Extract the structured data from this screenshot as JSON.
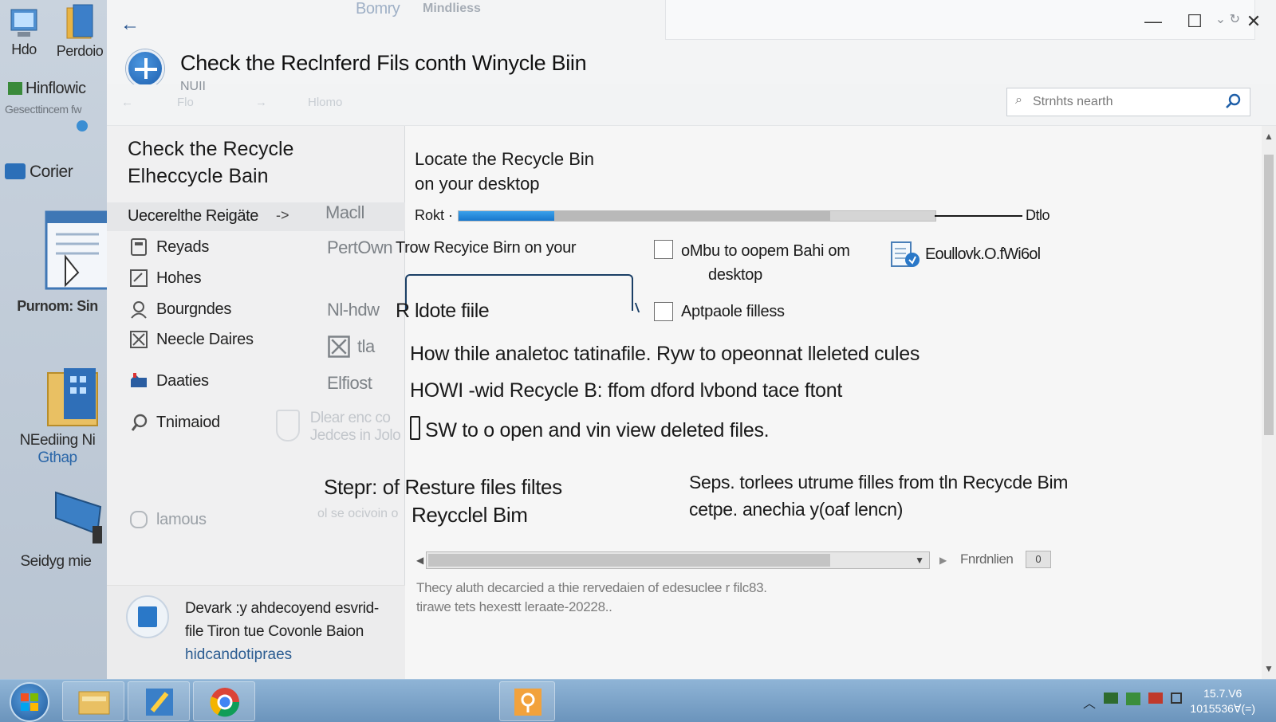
{
  "desktop": {
    "icons": [
      {
        "label": "Hdo"
      },
      {
        "label": "Perdoio"
      },
      {
        "label": "Hinflowic"
      },
      {
        "label": "Gesecttincem fw"
      },
      {
        "label": "Corier"
      },
      {
        "label": "Purnom: Sin"
      },
      {
        "label": "NEediing Ni"
      },
      {
        "label": "Gthap"
      },
      {
        "label": "Seidyg mie"
      }
    ]
  },
  "window": {
    "ghost_title": "Bomry",
    "ghost_sub": "Mindliess",
    "title": "Check the Reclnferd Fils conth Winycle Biin",
    "title_sub": "NUII",
    "controls": {
      "minimize": "—",
      "maximize": "☐",
      "close": "✕"
    },
    "cmdbar": {
      "faint_1": "Flo",
      "faint_2": "Hlomo"
    },
    "search": {
      "placeholder": "Strnhts nearth"
    }
  },
  "leftpane": {
    "heading_line1": "Check the Recycle",
    "heading_line2": "Elheccycle Bain",
    "selected": {
      "label": "Uecerelthe Reigäte",
      "arrow": "->"
    },
    "nav": [
      {
        "label": "Reyads",
        "icon": "recycle-bin-icon",
        "col2": "Macll"
      },
      {
        "label": "Hohes",
        "icon": "checkbox-icon",
        "col2": "PertOwn"
      },
      {
        "label": "Bourgndes",
        "icon": "person-icon",
        "col2": "Nl-hdw"
      },
      {
        "label": "Neecle Daires",
        "icon": "crossed-box-icon",
        "col2": "tla"
      },
      {
        "label": "Daaties",
        "icon": "folder-icon",
        "col2": "Elfiost"
      },
      {
        "label": "Tnimaiod",
        "icon": "link-icon",
        "col2": "Dlear enc co"
      },
      {
        "label": "lamous",
        "icon": "circle-icon",
        "col2": ""
      }
    ],
    "col2_extra": "Jedces in Jolo",
    "bottom": {
      "line1": "Devark :y ahdecoyend esvrid-",
      "line2": "file Tiron tue Covonle Baion",
      "link": "hidcandotipraes"
    }
  },
  "main": {
    "step_head_1": "Locate the Recycle Bin",
    "step_head_2": "on your desktop",
    "progress": {
      "label": "Rokt ·",
      "end_label": "Dtlo",
      "value": 0.2,
      "mid_value": 0.78
    },
    "row_text": "Trow Recyice Birn on your",
    "check_1": {
      "line1": "oMbu to oopem Bahi om",
      "line2": "desktop"
    },
    "doc_label": "Eoullovk.O.fWi6ol",
    "check_2": {
      "label": "Aptpaole filless"
    },
    "locate_text": "R ldote fiile",
    "line1": "How thile analetoc tatinafile. Ryw to opeonnat lleleted cules",
    "line2": "HOWI -wid Recycle B: ffom dford lvbond tace ftont",
    "line3": "SW  to o open and vin view deleted files.",
    "restore_head_1": "Stepr: of Resture files filtes",
    "restore_head_2": "Reycclel Bim",
    "restore_sub": "ol se ocivoin o",
    "restore_note_1": "Seps. torlees utrume filles from tln Recycde Bim",
    "restore_note_2": "cetpe. anechia y(oaf lencn)",
    "dropdown": {
      "label": "Fnrdnlien",
      "toggle": "0",
      "scroll_value": 0.8
    },
    "foot_1": "Thecy aluth decarcied a thie rervedaien of edesuclee r filc83.",
    "foot_2": "tirawe tets hexestt leraate-20228.."
  },
  "taskbar": {
    "clock_time": "15.7.V6",
    "clock_date": "1015536Ɐ(=)"
  }
}
